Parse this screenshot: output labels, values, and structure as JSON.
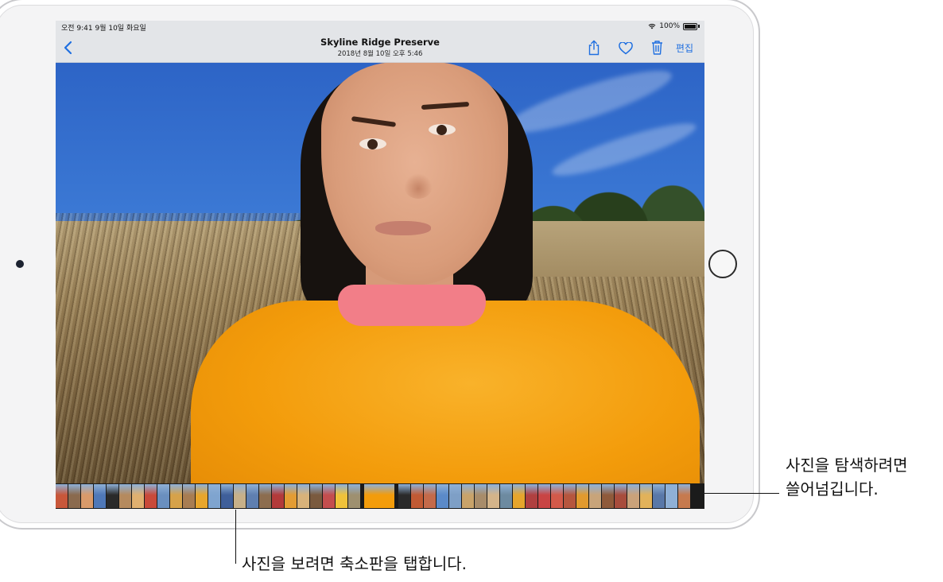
{
  "status_bar": {
    "time_date": "오전 9:41   9월 10일 화요일",
    "battery": "100%",
    "wifi_icon": "wifi-icon",
    "battery_icon": "battery-icon"
  },
  "nav": {
    "title": "Skyline Ridge Preserve",
    "subtitle": "2018년 8월 10일 오후 5:46",
    "edit_label": "편집",
    "accent_color": "#1f6fe0",
    "icons": [
      "chevron-left-icon",
      "share-icon",
      "heart-icon",
      "trash-icon"
    ]
  },
  "thumbnails": {
    "colors": [
      "#c8573a",
      "#8a6a4e",
      "#d99a6a",
      "#4f78b8",
      "#2a2a2a",
      "#b58a5e",
      "#e0b070",
      "#c94a3a",
      "#6a8fbf",
      "#d6a24a",
      "#a87d52",
      "#e8a62c",
      "#7fa4cf",
      "#3f5f9a",
      "#c7b089",
      "#5f7fb0",
      "#8c6d4f",
      "#b33a3a",
      "#e39c34",
      "#d8b27a",
      "#7a5a3e",
      "#c44e4e",
      "#f0c23a",
      "#9e9070",
      "#f39c0b",
      "#2a2a2a",
      "#c15a34",
      "#c46a4a",
      "#5b8ac9",
      "#7e9fc6",
      "#c9a36a",
      "#a88c6a",
      "#d4b48a",
      "#6d8aa0",
      "#e6a52c",
      "#b04040",
      "#c94444",
      "#d35a4a",
      "#b6563e",
      "#e29a2e",
      "#c8a47a",
      "#8f5a3a",
      "#a84c3c",
      "#caa27a",
      "#e2b25a",
      "#5978a8",
      "#8fb0d6",
      "#c67a4e"
    ],
    "selected_index": 24
  },
  "callouts": {
    "swipe": [
      "사진을 탐색하려면",
      "쓸어넘깁니다."
    ],
    "tap": "사진을 보려면 축소판을 탭합니다."
  }
}
